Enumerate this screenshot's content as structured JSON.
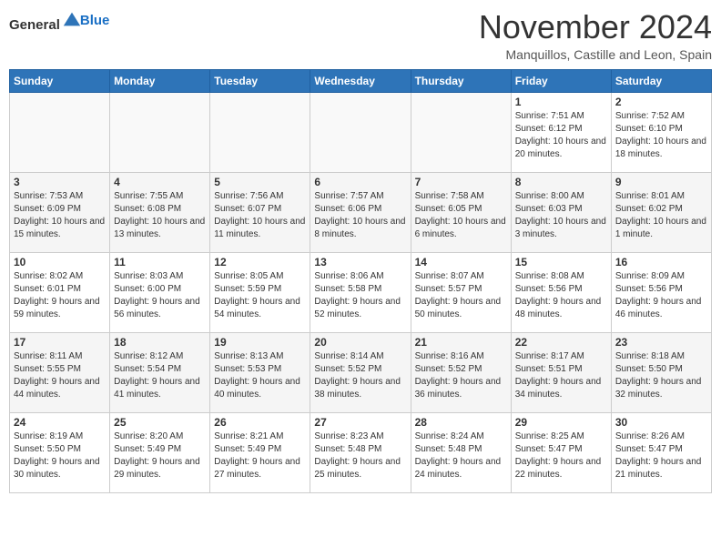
{
  "header": {
    "logo": {
      "general": "General",
      "blue": "Blue"
    },
    "title": "November 2024",
    "subtitle": "Manquillos, Castille and Leon, Spain"
  },
  "weekdays": [
    "Sunday",
    "Monday",
    "Tuesday",
    "Wednesday",
    "Thursday",
    "Friday",
    "Saturday"
  ],
  "weeks": [
    [
      {
        "day": "",
        "info": ""
      },
      {
        "day": "",
        "info": ""
      },
      {
        "day": "",
        "info": ""
      },
      {
        "day": "",
        "info": ""
      },
      {
        "day": "",
        "info": ""
      },
      {
        "day": "1",
        "info": "Sunrise: 7:51 AM\nSunset: 6:12 PM\nDaylight: 10 hours and 20 minutes."
      },
      {
        "day": "2",
        "info": "Sunrise: 7:52 AM\nSunset: 6:10 PM\nDaylight: 10 hours and 18 minutes."
      }
    ],
    [
      {
        "day": "3",
        "info": "Sunrise: 7:53 AM\nSunset: 6:09 PM\nDaylight: 10 hours and 15 minutes."
      },
      {
        "day": "4",
        "info": "Sunrise: 7:55 AM\nSunset: 6:08 PM\nDaylight: 10 hours and 13 minutes."
      },
      {
        "day": "5",
        "info": "Sunrise: 7:56 AM\nSunset: 6:07 PM\nDaylight: 10 hours and 11 minutes."
      },
      {
        "day": "6",
        "info": "Sunrise: 7:57 AM\nSunset: 6:06 PM\nDaylight: 10 hours and 8 minutes."
      },
      {
        "day": "7",
        "info": "Sunrise: 7:58 AM\nSunset: 6:05 PM\nDaylight: 10 hours and 6 minutes."
      },
      {
        "day": "8",
        "info": "Sunrise: 8:00 AM\nSunset: 6:03 PM\nDaylight: 10 hours and 3 minutes."
      },
      {
        "day": "9",
        "info": "Sunrise: 8:01 AM\nSunset: 6:02 PM\nDaylight: 10 hours and 1 minute."
      }
    ],
    [
      {
        "day": "10",
        "info": "Sunrise: 8:02 AM\nSunset: 6:01 PM\nDaylight: 9 hours and 59 minutes."
      },
      {
        "day": "11",
        "info": "Sunrise: 8:03 AM\nSunset: 6:00 PM\nDaylight: 9 hours and 56 minutes."
      },
      {
        "day": "12",
        "info": "Sunrise: 8:05 AM\nSunset: 5:59 PM\nDaylight: 9 hours and 54 minutes."
      },
      {
        "day": "13",
        "info": "Sunrise: 8:06 AM\nSunset: 5:58 PM\nDaylight: 9 hours and 52 minutes."
      },
      {
        "day": "14",
        "info": "Sunrise: 8:07 AM\nSunset: 5:57 PM\nDaylight: 9 hours and 50 minutes."
      },
      {
        "day": "15",
        "info": "Sunrise: 8:08 AM\nSunset: 5:56 PM\nDaylight: 9 hours and 48 minutes."
      },
      {
        "day": "16",
        "info": "Sunrise: 8:09 AM\nSunset: 5:56 PM\nDaylight: 9 hours and 46 minutes."
      }
    ],
    [
      {
        "day": "17",
        "info": "Sunrise: 8:11 AM\nSunset: 5:55 PM\nDaylight: 9 hours and 44 minutes."
      },
      {
        "day": "18",
        "info": "Sunrise: 8:12 AM\nSunset: 5:54 PM\nDaylight: 9 hours and 41 minutes."
      },
      {
        "day": "19",
        "info": "Sunrise: 8:13 AM\nSunset: 5:53 PM\nDaylight: 9 hours and 40 minutes."
      },
      {
        "day": "20",
        "info": "Sunrise: 8:14 AM\nSunset: 5:52 PM\nDaylight: 9 hours and 38 minutes."
      },
      {
        "day": "21",
        "info": "Sunrise: 8:16 AM\nSunset: 5:52 PM\nDaylight: 9 hours and 36 minutes."
      },
      {
        "day": "22",
        "info": "Sunrise: 8:17 AM\nSunset: 5:51 PM\nDaylight: 9 hours and 34 minutes."
      },
      {
        "day": "23",
        "info": "Sunrise: 8:18 AM\nSunset: 5:50 PM\nDaylight: 9 hours and 32 minutes."
      }
    ],
    [
      {
        "day": "24",
        "info": "Sunrise: 8:19 AM\nSunset: 5:50 PM\nDaylight: 9 hours and 30 minutes."
      },
      {
        "day": "25",
        "info": "Sunrise: 8:20 AM\nSunset: 5:49 PM\nDaylight: 9 hours and 29 minutes."
      },
      {
        "day": "26",
        "info": "Sunrise: 8:21 AM\nSunset: 5:49 PM\nDaylight: 9 hours and 27 minutes."
      },
      {
        "day": "27",
        "info": "Sunrise: 8:23 AM\nSunset: 5:48 PM\nDaylight: 9 hours and 25 minutes."
      },
      {
        "day": "28",
        "info": "Sunrise: 8:24 AM\nSunset: 5:48 PM\nDaylight: 9 hours and 24 minutes."
      },
      {
        "day": "29",
        "info": "Sunrise: 8:25 AM\nSunset: 5:47 PM\nDaylight: 9 hours and 22 minutes."
      },
      {
        "day": "30",
        "info": "Sunrise: 8:26 AM\nSunset: 5:47 PM\nDaylight: 9 hours and 21 minutes."
      }
    ]
  ]
}
